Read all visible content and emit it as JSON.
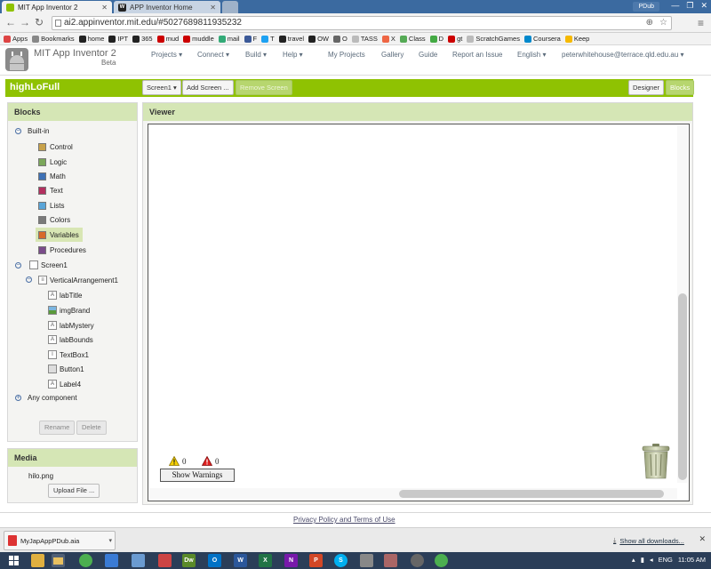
{
  "browser": {
    "tabs": [
      {
        "title": "MIT App Inventor 2",
        "active": true
      },
      {
        "title": "APP Inventor Home",
        "active": false
      }
    ],
    "user_badge": "PDub",
    "window_buttons": [
      "—",
      "❐",
      "✕"
    ],
    "url": "ai2.appinventor.mit.edu/#5027689811935232",
    "bookmarks": [
      {
        "label": "Apps",
        "color": "#d44"
      },
      {
        "label": "Bookmarks",
        "color": "#888"
      },
      {
        "label": "home",
        "color": "#222"
      },
      {
        "label": "IPT",
        "color": "#222"
      },
      {
        "label": "365",
        "color": "#222"
      },
      {
        "label": "mud",
        "color": "#c00"
      },
      {
        "label": "muddle",
        "color": "#c00"
      },
      {
        "label": "mail",
        "color": "#3a7"
      },
      {
        "label": "F",
        "color": "#3b5998"
      },
      {
        "label": "T",
        "color": "#1da1f2"
      },
      {
        "label": "travel",
        "color": "#222"
      },
      {
        "label": "OW",
        "color": "#222"
      },
      {
        "label": "O",
        "color": "#666"
      },
      {
        "label": "TASS",
        "color": "#bbb"
      },
      {
        "label": "X",
        "color": "#e64"
      },
      {
        "label": "Class",
        "color": "#5a5"
      },
      {
        "label": "D",
        "color": "#4a4"
      },
      {
        "label": "gt",
        "color": "#c00"
      },
      {
        "label": "ScratchGames",
        "color": "#bbb"
      },
      {
        "label": "Coursera",
        "color": "#08c"
      },
      {
        "label": "Keep",
        "color": "#f6b900"
      }
    ]
  },
  "app": {
    "title": "MIT App Inventor 2",
    "beta": "Beta",
    "menus": [
      "Projects ▾",
      "Connect ▾",
      "Build ▾",
      "Help ▾"
    ],
    "links": [
      "My Projects",
      "Gallery",
      "Guide",
      "Report an Issue",
      "English ▾",
      "peterwhitehouse@terrace.qld.edu.au ▾"
    ]
  },
  "project": {
    "name": "highLoFull",
    "screen_select": "Screen1 ▾",
    "add_screen": "Add Screen ...",
    "remove_screen": "Remove Screen",
    "designer": "Designer",
    "blocks": "Blocks"
  },
  "blocks_panel": {
    "title": "Blocks",
    "builtin_label": "Built-in",
    "builtin": [
      {
        "label": "Control",
        "color": "#c8a24a"
      },
      {
        "label": "Logic",
        "color": "#7ba75a"
      },
      {
        "label": "Math",
        "color": "#3f71b5"
      },
      {
        "label": "Text",
        "color": "#b3305f"
      },
      {
        "label": "Lists",
        "color": "#5aa5d8"
      },
      {
        "label": "Colors",
        "color": "#7a7a7a"
      },
      {
        "label": "Variables",
        "color": "#d86a2a"
      },
      {
        "label": "Procedures",
        "color": "#7a4c8a"
      }
    ],
    "screen_label": "Screen1",
    "arrangement_label": "VerticalArrangement1",
    "components": [
      {
        "label": "labTitle",
        "icon": "A"
      },
      {
        "label": "imgBrand",
        "icon": "img"
      },
      {
        "label": "labMystery",
        "icon": "A"
      },
      {
        "label": "labBounds",
        "icon": "A"
      },
      {
        "label": "TextBox1",
        "icon": "I"
      },
      {
        "label": "Button1",
        "icon": "btn"
      },
      {
        "label": "Label4",
        "icon": "A"
      }
    ],
    "any_component": "Any component",
    "rename": "Rename",
    "delete": "Delete"
  },
  "media_panel": {
    "title": "Media",
    "file": "hilo.png",
    "upload": "Upload File ..."
  },
  "viewer": {
    "title": "Viewer",
    "warning_count": "0",
    "error_count": "0",
    "show_warnings": "Show Warnings"
  },
  "footer": {
    "privacy": "Privacy Policy and Terms of Use"
  },
  "downloads": {
    "file": "MyJapAppPDub.aia",
    "show_all": "Show all downloads...",
    "close": "✕"
  },
  "taskbar": {
    "language": "ENG",
    "time": "11:05 AM"
  }
}
